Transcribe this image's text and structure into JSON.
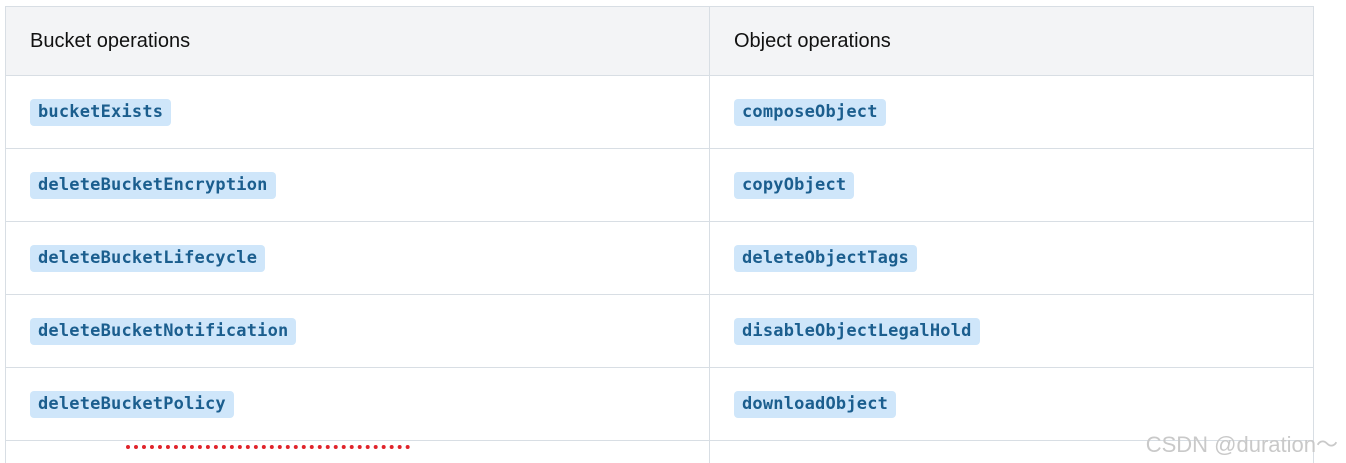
{
  "table": {
    "headers": [
      "Bucket operations",
      "Object operations"
    ],
    "rows": [
      [
        "bucketExists",
        "composeObject"
      ],
      [
        "deleteBucketEncryption",
        "copyObject"
      ],
      [
        "deleteBucketLifecycle",
        "deleteObjectTags"
      ],
      [
        "deleteBucketNotification",
        "disableObjectLegalHold"
      ],
      [
        "deleteBucketPolicy",
        "downloadObject"
      ]
    ]
  },
  "watermark": "CSDN @duration～",
  "colors": {
    "header_bg": "#f3f4f6",
    "border": "#d8dee4",
    "code_bg": "#cfe6fa",
    "code_text": "#1b5e8e",
    "annotation_red": "#e0242b"
  }
}
